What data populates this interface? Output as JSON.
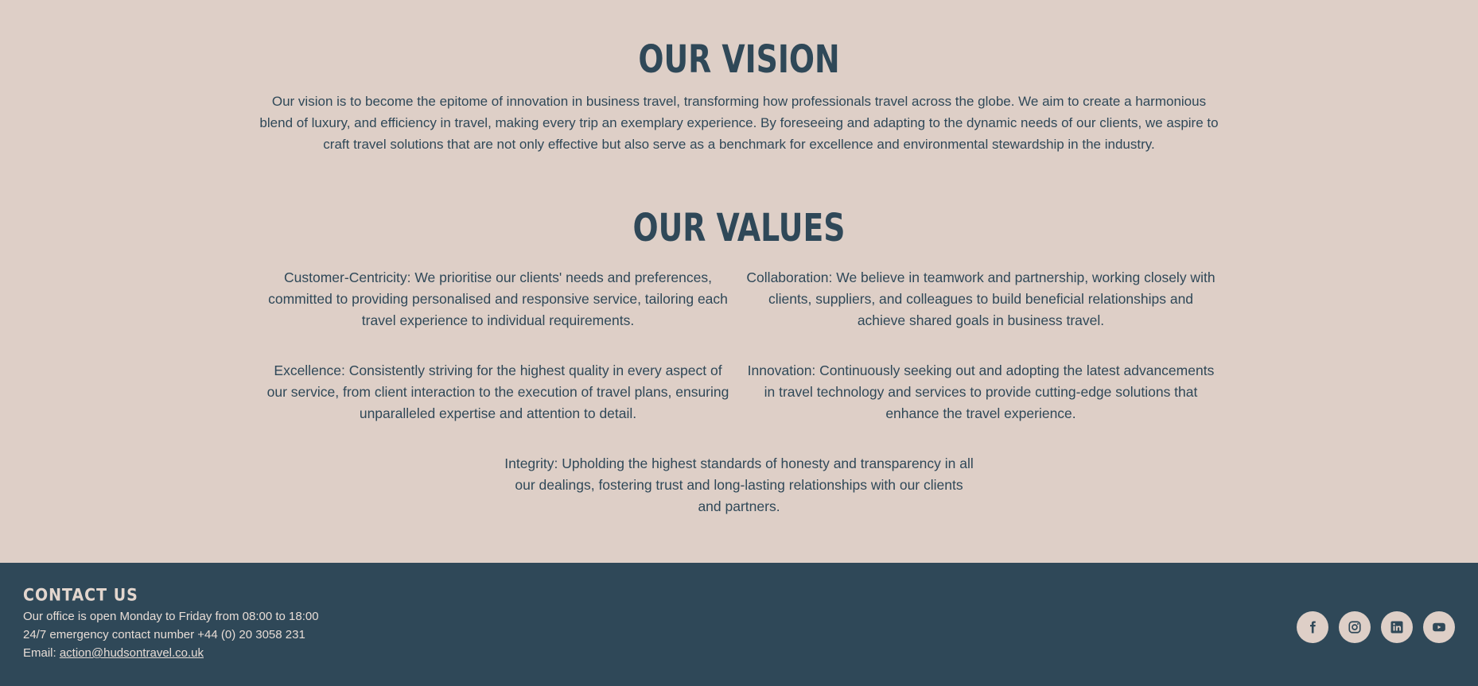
{
  "vision": {
    "title": "OUR VISION",
    "text": "Our vision is to become the epitome of innovation in business travel, transforming how professionals travel across the globe. We aim to create a harmonious blend of luxury, and efficiency in travel, making every trip an exemplary experience. By foreseeing and adapting to the dynamic needs of our clients, we aspire to craft travel solutions that are not only effective but also serve as a benchmark for excellence and environmental stewardship in the industry."
  },
  "values": {
    "title": "OUR VALUES",
    "items": [
      "Customer-Centricity: We prioritise our clients' needs and preferences, committed to providing personalised and responsive service, tailoring each travel experience to individual requirements.",
      "Collaboration: We believe in teamwork and partnership, working closely with clients, suppliers, and colleagues to build beneficial relationships and achieve shared goals in business travel.",
      "Excellence: Consistently striving for the highest quality in every aspect of our service, from client interaction to the execution of travel plans, ensuring unparalleled expertise and attention to detail.",
      "Innovation: Continuously seeking out and adopting the latest advancements in travel technology and services to provide cutting-edge solutions that enhance the travel experience.",
      "Integrity: Upholding the highest standards of honesty and transparency in all our dealings, fostering trust and long-lasting relationships with our clients and partners."
    ]
  },
  "footer": {
    "title": "CONTACT US",
    "hours": "Our office is open Monday to Friday from 08:00 to 18:00",
    "emergency": "24/7 emergency contact number +44 (0) 20 3058 231",
    "email_label": "Email: ",
    "email": "action@hudsontravel.co.uk",
    "socials": [
      "facebook-icon",
      "instagram-icon",
      "linkedin-icon",
      "youtube-icon"
    ]
  },
  "colors": {
    "background": "#decfc7",
    "text": "#2f4858",
    "footer_bg": "#2f4858",
    "footer_text": "#e8ddd6"
  }
}
